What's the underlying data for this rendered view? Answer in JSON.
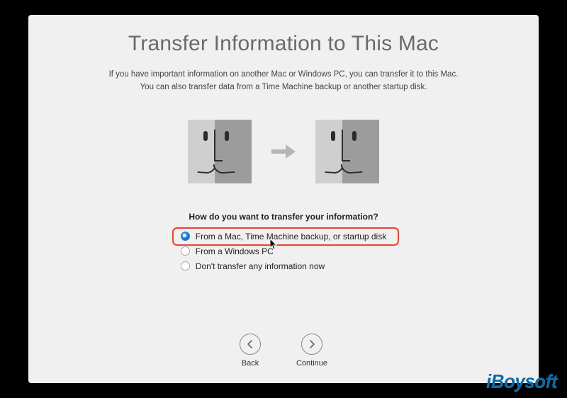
{
  "title": "Transfer Information to This Mac",
  "subtitle_line1": "If you have important information on another Mac or Windows PC, you can transfer it to this Mac.",
  "subtitle_line2": "You can also transfer data from a Time Machine backup or another startup disk.",
  "prompt": "How do you want to transfer your information?",
  "options": [
    {
      "label": "From a Mac, Time Machine backup, or startup disk",
      "selected": true
    },
    {
      "label": "From a Windows PC",
      "selected": false
    },
    {
      "label": "Don't transfer any information now",
      "selected": false
    }
  ],
  "nav": {
    "back": "Back",
    "continue": "Continue"
  },
  "watermark": "iBoysoft",
  "colors": {
    "highlight": "#e24a3a",
    "accent": "#1a7bd8"
  }
}
